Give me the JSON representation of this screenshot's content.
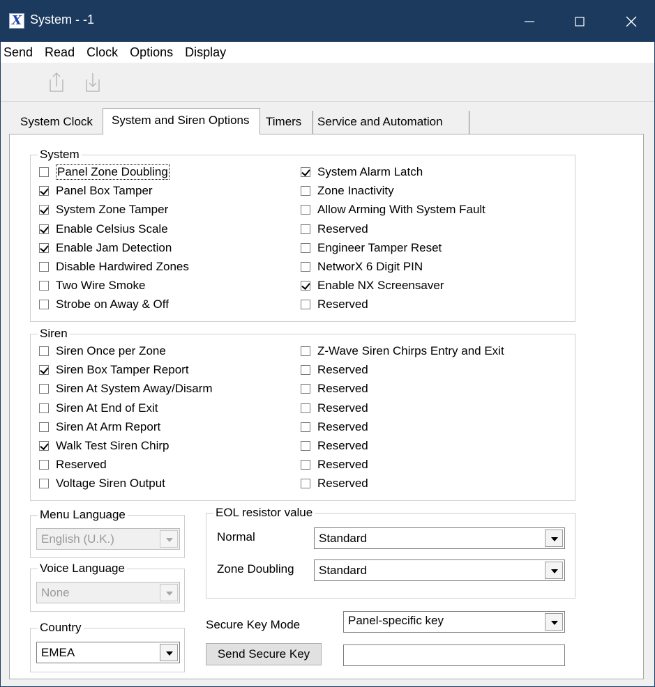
{
  "window": {
    "title": "System - -1",
    "app_icon_letter": "X"
  },
  "menubar": {
    "items": [
      "Send",
      "Read",
      "Clock",
      "Options",
      "Display"
    ]
  },
  "toolbar": {
    "icons": [
      "upload-icon",
      "download-icon"
    ]
  },
  "tabs": [
    {
      "label": "System Clock",
      "active": false
    },
    {
      "label": "System and Siren Options",
      "active": true
    },
    {
      "label": "Timers",
      "active": false
    },
    {
      "label": "Service and Automation",
      "active": false
    }
  ],
  "system_group": {
    "title": "System",
    "left": [
      {
        "label": "Panel Zone Doubling",
        "checked": false
      },
      {
        "label": "Panel Box Tamper",
        "checked": true
      },
      {
        "label": "System Zone Tamper",
        "checked": true
      },
      {
        "label": "Enable Celsius Scale",
        "checked": true
      },
      {
        "label": "Enable Jam Detection",
        "checked": true
      },
      {
        "label": "Disable Hardwired Zones",
        "checked": false
      },
      {
        "label": "Two Wire Smoke",
        "checked": false
      },
      {
        "label": "Strobe on Away & Off",
        "checked": false
      }
    ],
    "right": [
      {
        "label": "System Alarm Latch",
        "checked": true
      },
      {
        "label": "Zone Inactivity",
        "checked": false
      },
      {
        "label": "Allow Arming With System Fault",
        "checked": false
      },
      {
        "label": "Reserved",
        "checked": false
      },
      {
        "label": "Engineer Tamper Reset",
        "checked": false
      },
      {
        "label": "NetworX 6 Digit PIN",
        "checked": false
      },
      {
        "label": "Enable NX Screensaver",
        "checked": true
      },
      {
        "label": "Reserved",
        "checked": false
      }
    ]
  },
  "siren_group": {
    "title": "Siren",
    "left": [
      {
        "label": "Siren Once per Zone",
        "checked": false
      },
      {
        "label": "Siren Box Tamper Report",
        "checked": true
      },
      {
        "label": "Siren At System Away/Disarm",
        "checked": false
      },
      {
        "label": "Siren At End of Exit",
        "checked": false
      },
      {
        "label": "Siren At Arm Report",
        "checked": false
      },
      {
        "label": "Walk Test Siren Chirp",
        "checked": true
      },
      {
        "label": "Reserved",
        "checked": false
      },
      {
        "label": "Voltage Siren Output",
        "checked": false
      }
    ],
    "right": [
      {
        "label": "Z-Wave Siren Chirps Entry and Exit",
        "checked": false
      },
      {
        "label": "Reserved",
        "checked": false
      },
      {
        "label": "Reserved",
        "checked": false
      },
      {
        "label": "Reserved",
        "checked": false
      },
      {
        "label": "Reserved",
        "checked": false
      },
      {
        "label": "Reserved",
        "checked": false
      },
      {
        "label": "Reserved",
        "checked": false
      },
      {
        "label": "Reserved",
        "checked": false
      }
    ]
  },
  "menu_language": {
    "title": "Menu Language",
    "value": "English (U.K.)"
  },
  "voice_language": {
    "title": "Voice Language",
    "value": "None"
  },
  "country": {
    "title": "Country",
    "value": "EMEA"
  },
  "eol": {
    "title": "EOL resistor value",
    "normal_label": "Normal",
    "normal_value": "Standard",
    "doubling_label": "Zone Doubling",
    "doubling_value": "Standard"
  },
  "secure_key": {
    "mode_label": "Secure Key Mode",
    "mode_value": "Panel-specific key",
    "send_button": "Send Secure Key",
    "key_value": ""
  }
}
